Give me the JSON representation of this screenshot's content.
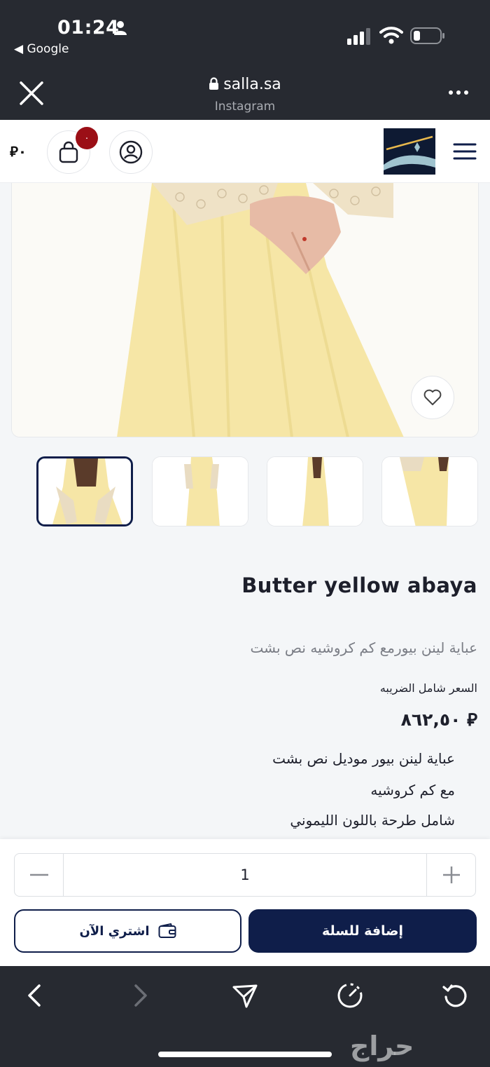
{
  "status_bar": {
    "time": "01:24",
    "back_app": "◀ Google"
  },
  "browser": {
    "domain": "salla.sa",
    "source": "Instagram"
  },
  "header": {
    "cart_total": "⃁٠",
    "cart_count": "٠"
  },
  "product": {
    "title": "Butter yellow abaya",
    "subtitle": "عباية لينن بيورمع كم كروشيه نص بشت",
    "price_label": "السعر شامل الضريبه",
    "price": "⃁ ٨٦٢,٥٠",
    "description": [
      "عباية لينن بيور موديل نص بشت",
      "مع كم كروشيه",
      "شامل طرحة باللون الليموني"
    ]
  },
  "quantity": {
    "value": "1"
  },
  "actions": {
    "buy_now": "اشتري الآن",
    "add_to_cart": "إضافة للسلة"
  },
  "watermark": "حراج",
  "colors": {
    "brand_navy": "#0f1e4a",
    "badge_red": "#9b0f16",
    "chrome_dark": "#272a31"
  }
}
